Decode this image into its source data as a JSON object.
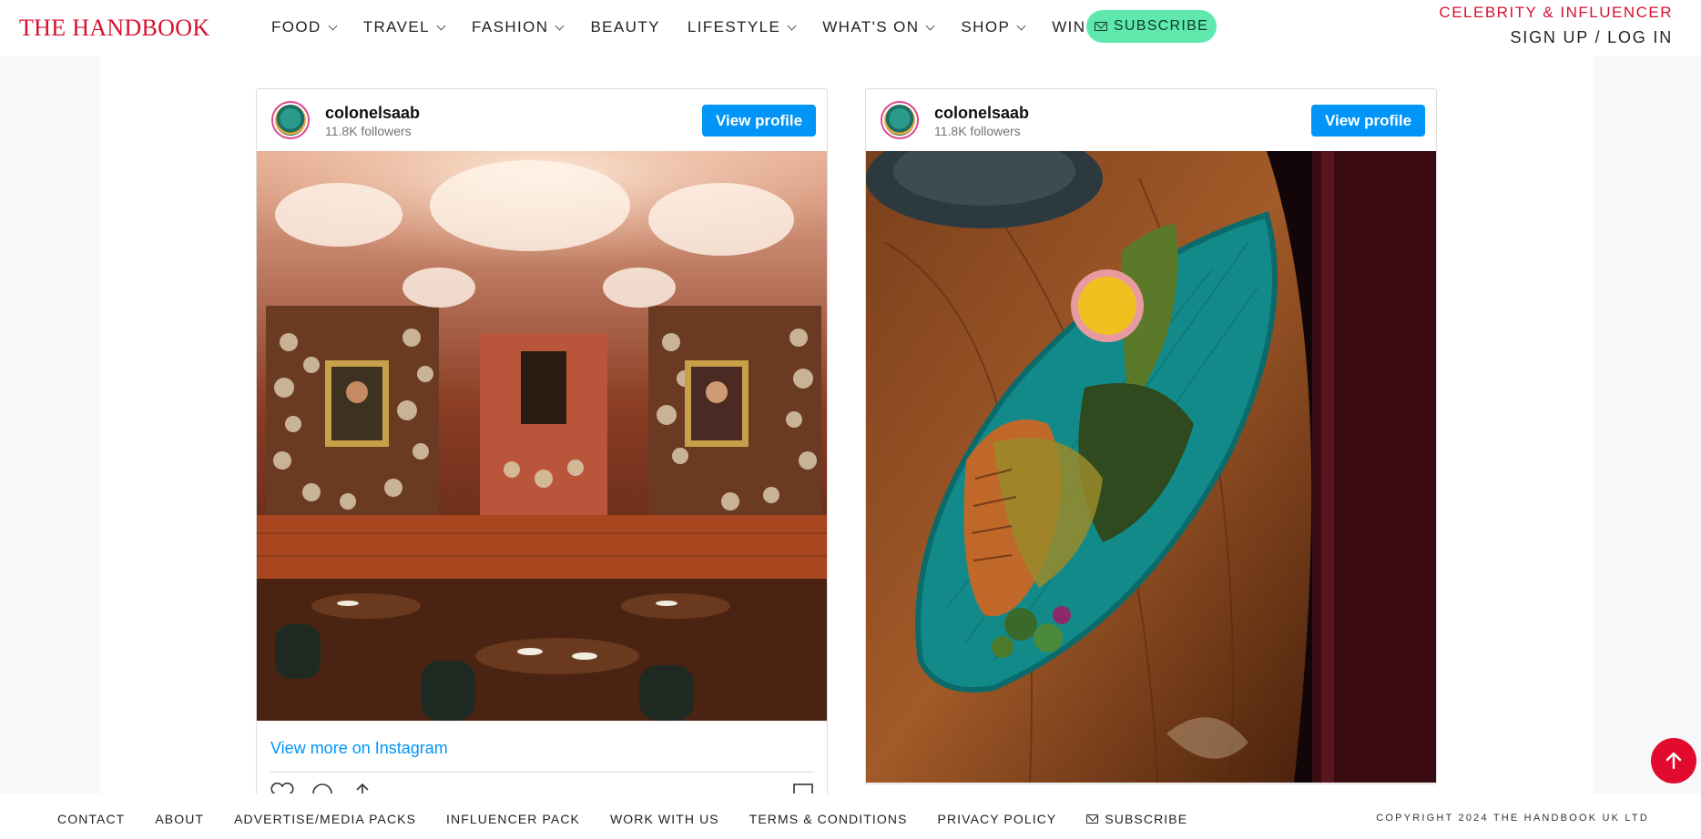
{
  "header": {
    "logo": "THE HANDBOOK",
    "nav": [
      {
        "label": "FOOD",
        "dropdown": true
      },
      {
        "label": "TRAVEL",
        "dropdown": true
      },
      {
        "label": "FASHION",
        "dropdown": true
      },
      {
        "label": "BEAUTY",
        "dropdown": false
      },
      {
        "label": "LIFESTYLE",
        "dropdown": true
      },
      {
        "label": "WHAT'S ON",
        "dropdown": true
      },
      {
        "label": "SHOP",
        "dropdown": true
      },
      {
        "label": "WIN",
        "dropdown": true
      }
    ],
    "subscribe": "SUBSCRIBE",
    "celebrity": "CELEBRITY & INFLUENCER",
    "signin": "SIGN UP / LOG IN"
  },
  "posts": [
    {
      "username": "colonelsaab",
      "followers": "11.8K followers",
      "view_profile": "View profile",
      "view_more": "View more on Instagram"
    },
    {
      "username": "colonelsaab",
      "followers": "11.8K followers",
      "view_profile": "View profile"
    }
  ],
  "footer": {
    "links": [
      "CONTACT",
      "ABOUT",
      "ADVERTISE/MEDIA PACKS",
      "INFLUENCER PACK",
      "WORK WITH US",
      "TERMS & CONDITIONS",
      "PRIVACY POLICY"
    ],
    "subscribe": "SUBSCRIBE",
    "copyright": "COPYRIGHT 2024 THE HANDBOOK UK LTD"
  },
  "colors": {
    "brand": "#d80f2f",
    "subscribe_bg": "#5ee8ac",
    "instagram_blue": "#0095f6"
  },
  "icons": [
    "search-icon",
    "mail-icon",
    "chevron-down-icon",
    "heart-icon",
    "comment-icon",
    "share-icon",
    "bookmark-icon",
    "arrow-up-icon"
  ]
}
